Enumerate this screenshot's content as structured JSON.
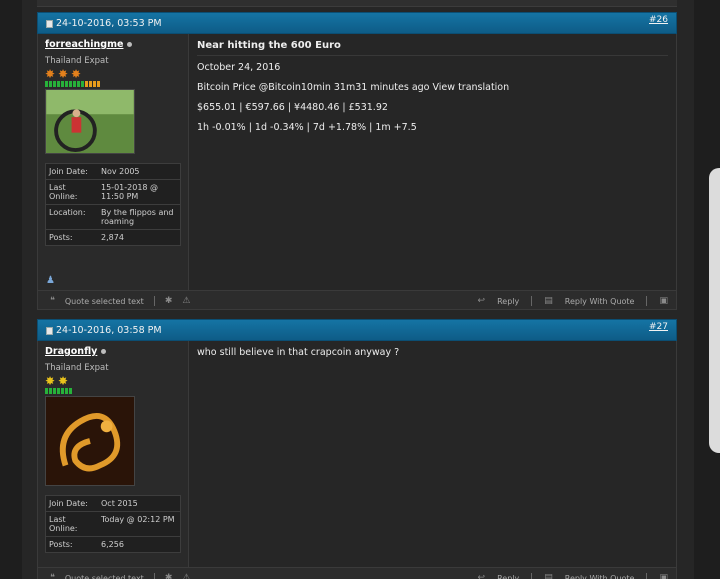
{
  "posts": [
    {
      "date": "24-10-2016, 03:53 PM",
      "number": "#26",
      "user": {
        "name": "forreachingme",
        "title": "Thailand Expat",
        "stars": 3,
        "info": [
          {
            "label": "Join Date:",
            "value": "Nov 2005"
          },
          {
            "label": "Last Online:",
            "value": "15-01-2018 @ 11:50 PM"
          },
          {
            "label": "Location:",
            "value": "By the flippos and roaming"
          },
          {
            "label": "Posts:",
            "value": "2,874"
          }
        ]
      },
      "title": "Near hitting the 600 Euro",
      "lines": [
        "October 24, 2016",
        "Bitcoin Price @Bitcoin10min 31m31 minutes ago View translation",
        "$655.01 | €597.66 | ¥4480.46 | £531.92",
        "1h -0.01% | 1d -0.34% | 7d +1.78% | 1m +7.5"
      ]
    },
    {
      "date": "24-10-2016, 03:58 PM",
      "number": "#27",
      "user": {
        "name": "Dragonfly",
        "title": "Thailand Expat",
        "stars": 2,
        "info": [
          {
            "label": "Join Date:",
            "value": "Oct 2015"
          },
          {
            "label": "Last Online:",
            "value": "Today @ 02:12 PM"
          },
          {
            "label": "Posts:",
            "value": "6,256"
          }
        ]
      },
      "title": "",
      "lines": [
        "who still believe in that crapcoin anyway ?"
      ]
    }
  ],
  "footer": {
    "quote_selected": "Quote selected text",
    "reply": "Reply",
    "reply_with_quote": "Reply With Quote"
  }
}
